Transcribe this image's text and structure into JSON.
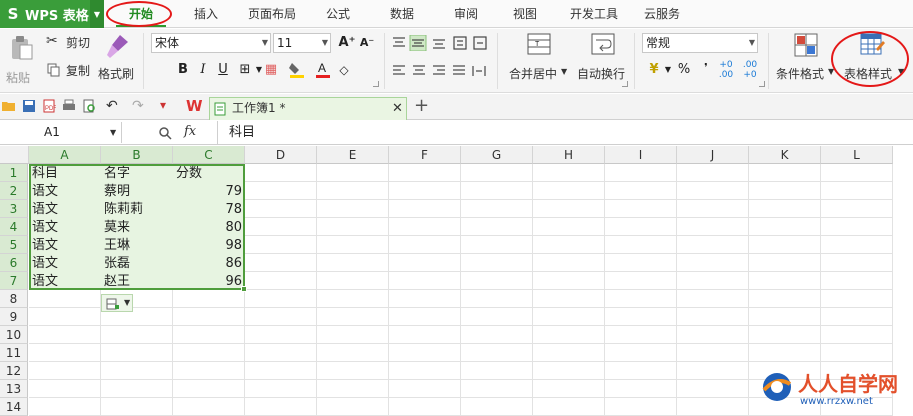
{
  "app": {
    "name": "WPS 表格",
    "logo": "S"
  },
  "menu": {
    "tabs": [
      "开始",
      "插入",
      "页面布局",
      "公式",
      "数据",
      "审阅",
      "视图",
      "开发工具",
      "云服务"
    ]
  },
  "ribbon": {
    "clipboard": {
      "paste": "粘贴",
      "cut": "剪切",
      "copy": "复制",
      "format_painter": "格式刷"
    },
    "font": {
      "name": "宋体",
      "size": "11",
      "bold": "B",
      "italic": "I",
      "underline": "U"
    },
    "alignment": {
      "merge_center": "合并居中",
      "wrap_text": "自动换行"
    },
    "number": {
      "format": "常规",
      "percent": "%",
      "thousands": "000",
      "inc_decimal": "+0 .00",
      "dec_decimal": ".00 +0"
    },
    "styles": {
      "conditional_format": "条件格式",
      "table_style": "表格样式"
    }
  },
  "doc_tab": {
    "title": "工作簿1 *"
  },
  "formula_bar": {
    "name_box": "A1",
    "fx": "fx",
    "content": "科目"
  },
  "columns": [
    "A",
    "B",
    "C",
    "D",
    "E",
    "F",
    "G",
    "H",
    "I",
    "J",
    "K",
    "L"
  ],
  "rows": [
    "1",
    "2",
    "3",
    "4",
    "5",
    "6",
    "7",
    "8",
    "9",
    "10",
    "11",
    "12",
    "13",
    "14"
  ],
  "table": {
    "header": [
      "科目",
      "名字",
      "分数"
    ],
    "rows": [
      [
        "语文",
        "蔡明",
        "79"
      ],
      [
        "语文",
        "陈莉莉",
        "78"
      ],
      [
        "语文",
        "莫来",
        "80"
      ],
      [
        "语文",
        "王琳",
        "98"
      ],
      [
        "语文",
        "张磊",
        "86"
      ],
      [
        "语文",
        "赵王",
        "96"
      ]
    ]
  },
  "watermark": {
    "cn": "人人自学网",
    "url": "www.rrzxw.net"
  },
  "colors": {
    "accent": "#3a9d3a",
    "selection": "#e7f4e1",
    "highlight": "#e41818"
  }
}
